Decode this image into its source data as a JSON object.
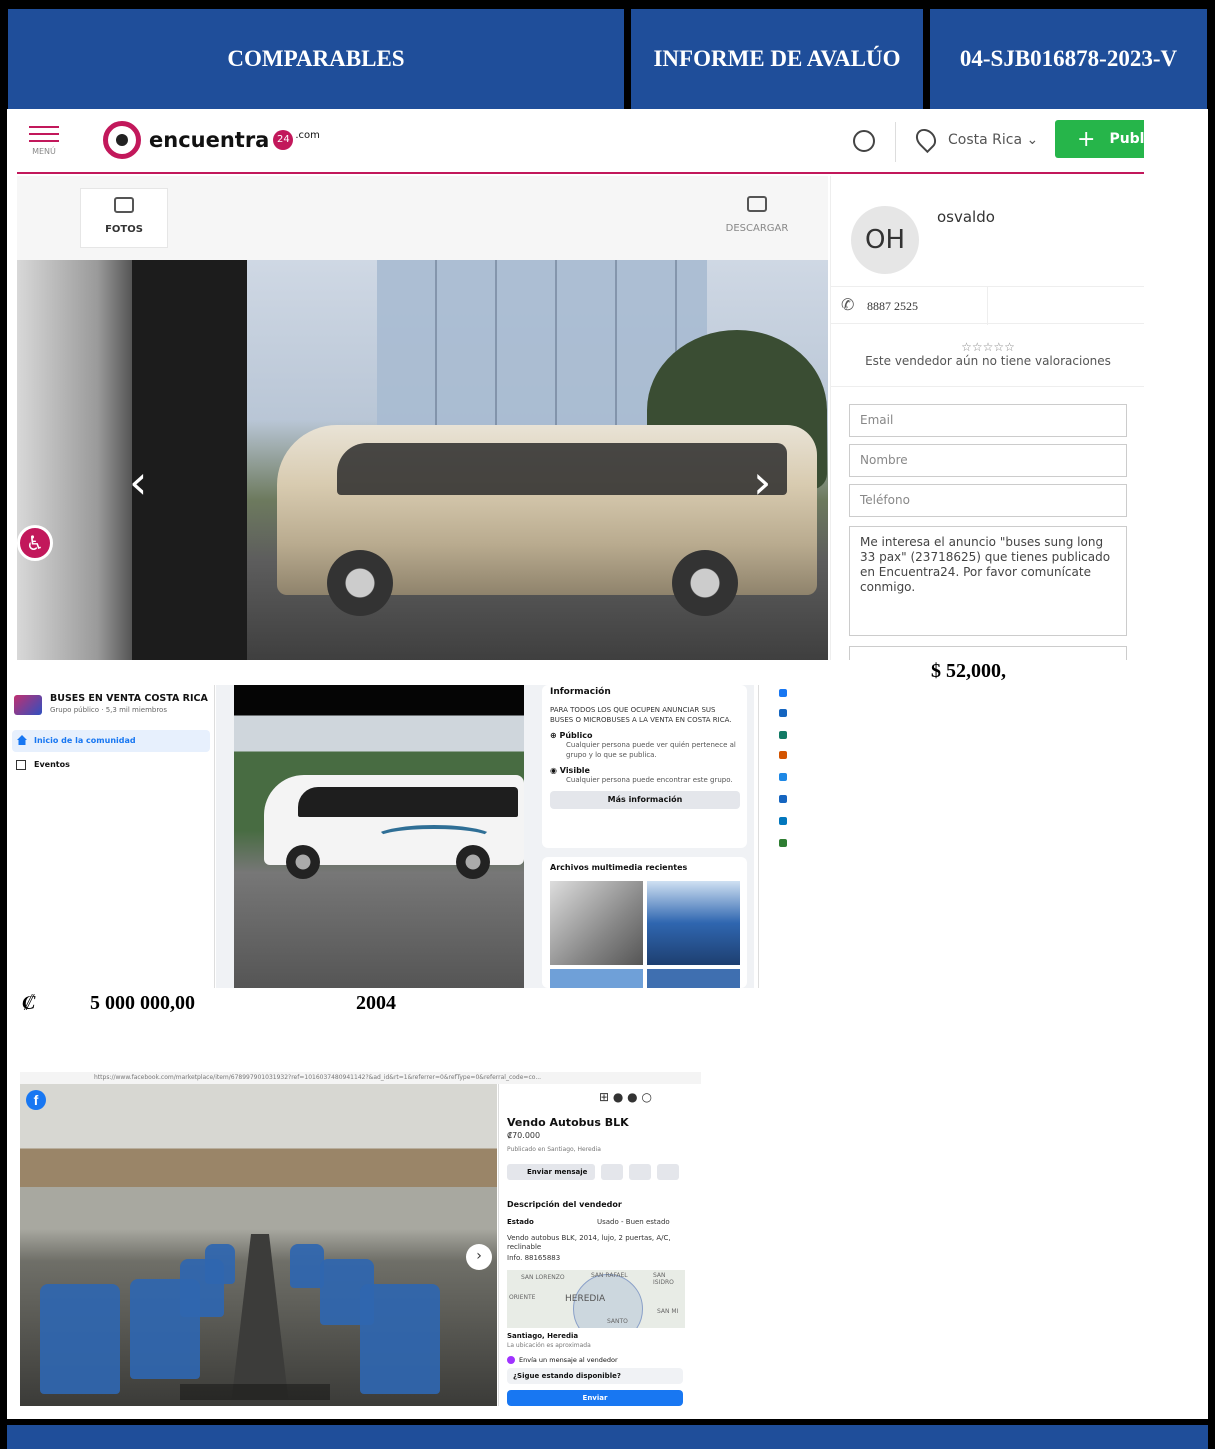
{
  "header": {
    "cell1": "COMPARABLES",
    "cell2": "INFORME DE AVALÚO",
    "cell3": "04-SJB016878-2023-V",
    "color": "#1f4e9a"
  },
  "comparable1": {
    "site": {
      "menu_label": "MENÚ",
      "logo_text": "encuentra",
      "logo_badge": "24",
      "logo_suffix": ".com",
      "country": "Costa Rica",
      "publish_label": "Publi",
      "accent": "#c2185b",
      "green": "#26b54a"
    },
    "tabs": {
      "photos": "FOTOS",
      "download": "DESCARGAR"
    },
    "seller": {
      "initials": "OH",
      "name": "osvaldo",
      "phone": "8887 2525",
      "stars": "☆☆☆☆☆",
      "rating_text": "Este vendedor aún no tiene valoraciones"
    },
    "form": {
      "email_placeholder": "Email",
      "name_placeholder": "Nombre",
      "phone_placeholder": "Teléfono",
      "message": "Me interesa el anuncio \"buses sung long 33 pax\" (23718625) que tienes publicado en Encuentra24. Por favor comunícate conmigo."
    },
    "price": "$ 52,000,"
  },
  "comparable2": {
    "group_name": "BUSES EN VENTA COSTA RICA",
    "group_meta": "Grupo público · 5,3 mil miembros",
    "nav_home": "Inicio de la comunidad",
    "nav_events": "Eventos",
    "info_title": "Información",
    "info_desc": "PARA TODOS LOS QUE OCUPEN ANUNCIAR SUS BUSES O MICROBUSES A LA VENTA EN COSTA RICA.",
    "public_title": "Público",
    "public_desc": "Cualquier persona puede ver quién pertenece al grupo y lo que se publica.",
    "visible_title": "Visible",
    "visible_desc": "Cualquier persona puede encontrar este grupo.",
    "more_button": "Más información",
    "media_title": "Archivos multimedia recientes",
    "currency_symbol": "₡",
    "price": "5 000 000,00",
    "year": "2004"
  },
  "comparable3": {
    "url": "https://www.facebook.com/marketplace/item/678997901031932?ref=1016037480941142?&ad_id&rt=1&referrer=0&refType=0&referral_code=co...",
    "title": "Vendo Autobus BLK",
    "price": "₡70.000",
    "location": "Publicado en Santiago, Heredia",
    "send_message": "Enviar mensaje",
    "desc_heading": "Descripción del vendedor",
    "state_label": "Estado",
    "state_value": "Usado - Buen estado",
    "description": "Vendo autobus BLK, 2014, lujo, 2 puertas, A/C, reclinable",
    "info": "Info. 88165883",
    "map": {
      "city_center": "HEREDIA",
      "l1": "SAN LORENZO",
      "l2": "SAN RAFAEL",
      "l3": "SAN ISIDRO",
      "l4": "ORIENTE",
      "l5": "SANTO",
      "l6": "SAN MI"
    },
    "city": "Santiago, Heredia",
    "approx": "La ubicación es aproximada",
    "message_seller": "Envía un mensaje al vendedor",
    "question": "¿Sigue estando disponible?",
    "send_button": "Enviar"
  }
}
